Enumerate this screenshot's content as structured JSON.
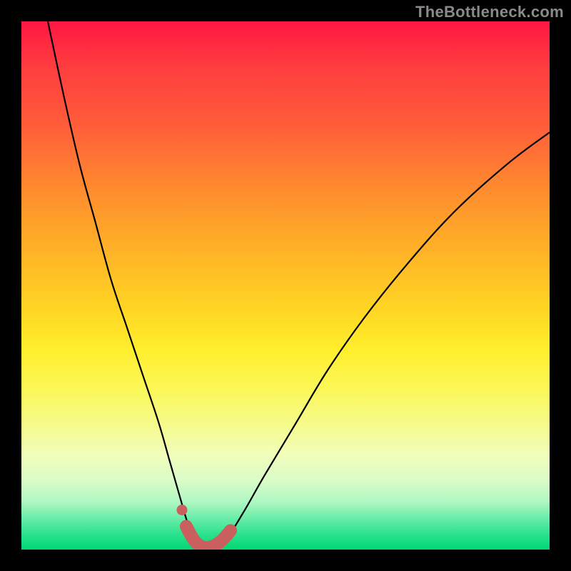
{
  "watermark": {
    "text": "TheBottleneck.com"
  },
  "colors": {
    "frame": "#000000",
    "curve_stroke": "#000000",
    "marker": "#c9605f",
    "gradient_top": "#ff1744",
    "gradient_bottom": "#00d873"
  },
  "chart_data": {
    "type": "line",
    "title": "",
    "xlabel": "",
    "ylabel": "",
    "xlim": [
      0,
      100
    ],
    "ylim": [
      0,
      100
    ],
    "grid": false,
    "legend": false,
    "annotations": [],
    "series": [
      {
        "name": "curve",
        "x": [
          5,
          8,
          11,
          14,
          17,
          20,
          23,
          26,
          28,
          30,
          31.5,
          33,
          34.5,
          36,
          39,
          42,
          46,
          52,
          58,
          65,
          73,
          82,
          92,
          100
        ],
        "values": [
          100,
          86,
          73,
          62,
          51,
          42,
          33,
          24,
          17,
          10,
          5,
          2,
          0.5,
          0.6,
          2.5,
          7,
          14,
          24,
          34,
          44,
          54,
          64,
          73,
          79
        ]
      }
    ],
    "markers": {
      "name": "bottom-highlight",
      "color": "#c9605f",
      "x": [
        31.2,
        32.6,
        34.0,
        35.4,
        36.8,
        38.2,
        39.6
      ],
      "values": [
        4.4,
        1.9,
        0.6,
        0.4,
        0.9,
        2.0,
        3.6
      ]
    }
  }
}
